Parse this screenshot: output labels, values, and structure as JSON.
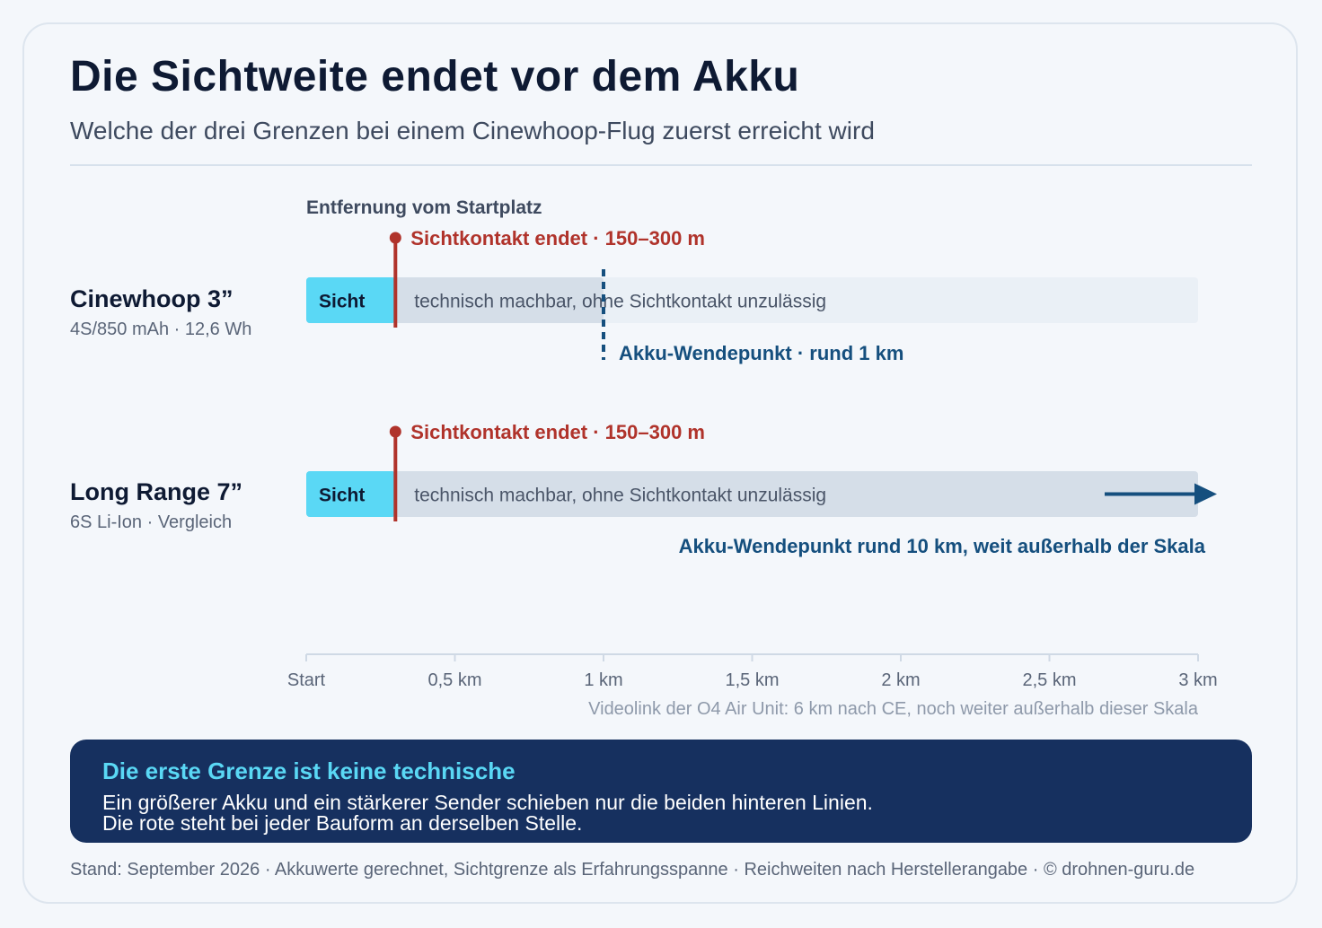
{
  "header": {
    "title": "Die Sichtweite endet vor dem Akku",
    "subtitle": "Welche der drei Grenzen bei einem Cinewhoop-Flug zuerst erreicht wird"
  },
  "colors": {
    "sight": "#5ad8f5",
    "tech": "#d5dee8",
    "tech_light": "#eaf0f6",
    "sight_limit": "#b0332b",
    "battery": "#154f7e",
    "note_bg": "#16305f",
    "note_title": "#5ad8f5"
  },
  "chart_data": {
    "type": "bar",
    "title": "Die Sichtweite endet vor dem Akku",
    "subtitle": "Welche der drei Grenzen bei einem Cinewhoop-Flug zuerst erreicht wird",
    "xlabel": "Entfernung vom Startplatz",
    "xlim": [
      0,
      3
    ],
    "x_unit": "km",
    "ticks": [
      {
        "value": 0,
        "label": "Start"
      },
      {
        "value": 0.5,
        "label": "0,5 km"
      },
      {
        "value": 1,
        "label": "1 km"
      },
      {
        "value": 1.5,
        "label": "1,5 km"
      },
      {
        "value": 2,
        "label": "2 km"
      },
      {
        "value": 2.5,
        "label": "2,5 km"
      },
      {
        "value": 3,
        "label": "3 km"
      }
    ],
    "axis_note": "Videolink der O4 Air Unit: 6 km nach CE, noch weiter außerhalb dieser Skala",
    "rows": [
      {
        "name": "Cinewhoop 3”",
        "sub": "4S/850 mAh · 12,6 Wh",
        "sight_label": "Sicht",
        "sight_end": 0.3,
        "tech_label": "technisch machbar, ohne Sichtkontakt unzulässig",
        "sight_limit_label": "Sichtkontakt endet · 150–300 m",
        "battery_turnaround": 1,
        "battery_label": "Akku-Wendepunkt · rund 1 km",
        "beyond_scale": false
      },
      {
        "name": "Long Range 7”",
        "sub": "6S Li-Ion · Vergleich",
        "sight_label": "Sicht",
        "sight_end": 0.3,
        "tech_label": "technisch machbar, ohne Sichtkontakt unzulässig",
        "sight_limit_label": "Sichtkontakt endet · 150–300 m",
        "battery_turnaround": 10,
        "battery_label": "Akku-Wendepunkt rund 10 km, weit außerhalb der Skala",
        "beyond_scale": true
      }
    ]
  },
  "note": {
    "title": "Die erste Grenze ist keine technische",
    "line1": "Ein größerer Akku und ein stärkerer Sender schieben nur die beiden hinteren Linien.",
    "line2": "Die rote steht bei jeder Bauform an derselben Stelle."
  },
  "footer": "Stand: September 2026 · Akkuwerte gerechnet, Sichtgrenze als Erfahrungsspanne · Reichweiten nach Herstellerangabe · © drohnen-guru.de"
}
